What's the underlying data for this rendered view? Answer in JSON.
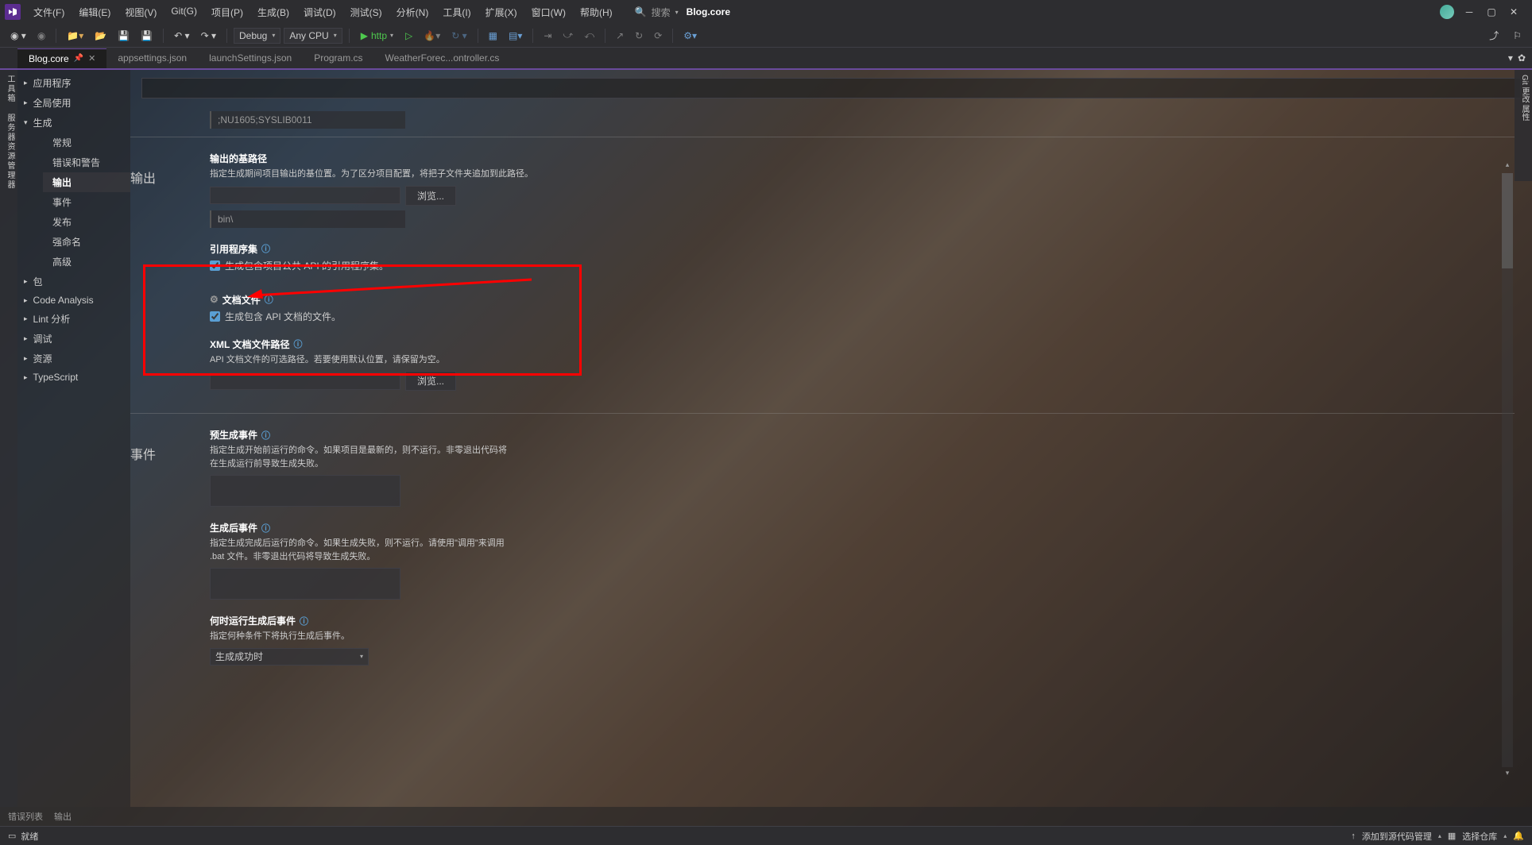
{
  "titlebar": {
    "menus": [
      "文件(F)",
      "编辑(E)",
      "视图(V)",
      "Git(G)",
      "项目(P)",
      "生成(B)",
      "调试(D)",
      "测试(S)",
      "分析(N)",
      "工具(I)",
      "扩展(X)",
      "窗口(W)",
      "帮助(H)"
    ],
    "search_placeholder": "搜索",
    "project_name": "Blog.core"
  },
  "toolbar": {
    "config": "Debug",
    "platform": "Any CPU",
    "run_label": "http"
  },
  "tabs": [
    {
      "label": "Blog.core",
      "active": true,
      "pinned": true
    },
    {
      "label": "appsettings.json",
      "active": false
    },
    {
      "label": "launchSettings.json",
      "active": false
    },
    {
      "label": "Program.cs",
      "active": false
    },
    {
      "label": "WeatherForec...ontroller.cs",
      "active": false
    }
  ],
  "sidebar": {
    "items": [
      {
        "label": "应用程序",
        "expandable": true
      },
      {
        "label": "全局使用",
        "expandable": true
      },
      {
        "label": "生成",
        "expanded": true,
        "children": [
          {
            "label": "常规"
          },
          {
            "label": "错误和警告"
          },
          {
            "label": "输出",
            "selected": true
          },
          {
            "label": "事件"
          },
          {
            "label": "发布"
          },
          {
            "label": "强命名"
          },
          {
            "label": "高级"
          }
        ]
      },
      {
        "label": "包",
        "expandable": true
      },
      {
        "label": "Code Analysis",
        "expandable": true
      },
      {
        "label": "Lint 分析",
        "expandable": true
      },
      {
        "label": "调试",
        "expandable": true
      },
      {
        "label": "资源",
        "expandable": true
      },
      {
        "label": "TypeScript",
        "expandable": true
      }
    ]
  },
  "content": {
    "warning_codes": ";NU1605;SYSLIB0011",
    "section_output": "输出",
    "base_path": {
      "label": "输出的基路径",
      "desc": "指定生成期间项目输出的基位置。为了区分项目配置，将把子文件夹追加到此路径。",
      "browse": "浏览...",
      "readonly_value": "bin\\"
    },
    "reference_assembly": {
      "label": "引用程序集",
      "checkbox_label": "生成包含项目公共 API 的引用程序集。"
    },
    "doc_file": {
      "label": "文档文件",
      "checkbox_label": "生成包含 API 文档的文件。"
    },
    "xml_path": {
      "label": "XML 文档文件路径",
      "desc": "API 文档文件的可选路径。若要使用默认位置，请保留为空。",
      "browse": "浏览..."
    },
    "section_events": "事件",
    "pre_build": {
      "label": "预生成事件",
      "desc": "指定生成开始前运行的命令。如果项目是最新的，则不运行。非零退出代码将在生成运行前导致生成失败。"
    },
    "post_build": {
      "label": "生成后事件",
      "desc": "指定生成完成后运行的命令。如果生成失败，则不运行。请使用\"调用\"来调用 .bat 文件。非零退出代码将导致生成失败。"
    },
    "when_run": {
      "label": "何时运行生成后事件",
      "desc": "指定何种条件下将执行生成后事件。",
      "selected": "生成成功时"
    }
  },
  "bottom_tabs": [
    "错误列表",
    "输出"
  ],
  "statusbar": {
    "ready": "就绪",
    "source_control": "添加到源代码管理",
    "misc": "选择仓库",
    "notif_icon": "🔔"
  },
  "right_panels": [
    "Git 更改",
    "属性"
  ]
}
